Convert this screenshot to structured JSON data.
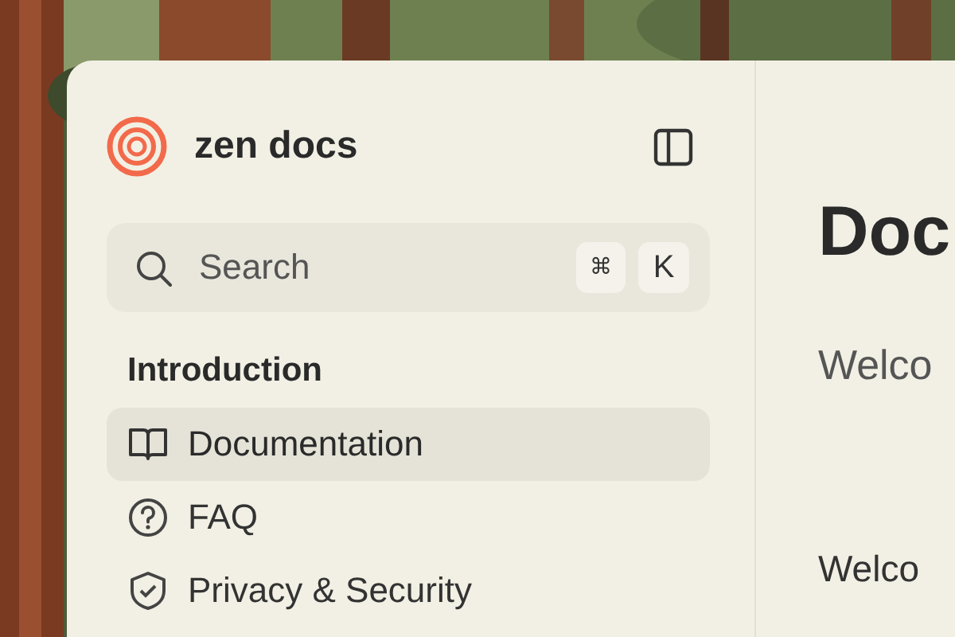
{
  "sidebar": {
    "title": "zen docs",
    "search": {
      "placeholder": "Search",
      "keys": [
        "⌘",
        "K"
      ]
    },
    "section": "Introduction",
    "items": [
      {
        "label": "Documentation",
        "selected": true
      },
      {
        "label": "FAQ",
        "selected": false
      },
      {
        "label": "Privacy & Security",
        "selected": false
      }
    ]
  },
  "main": {
    "heading": "Doc",
    "lead": "Welco",
    "subheading": "Welco"
  }
}
